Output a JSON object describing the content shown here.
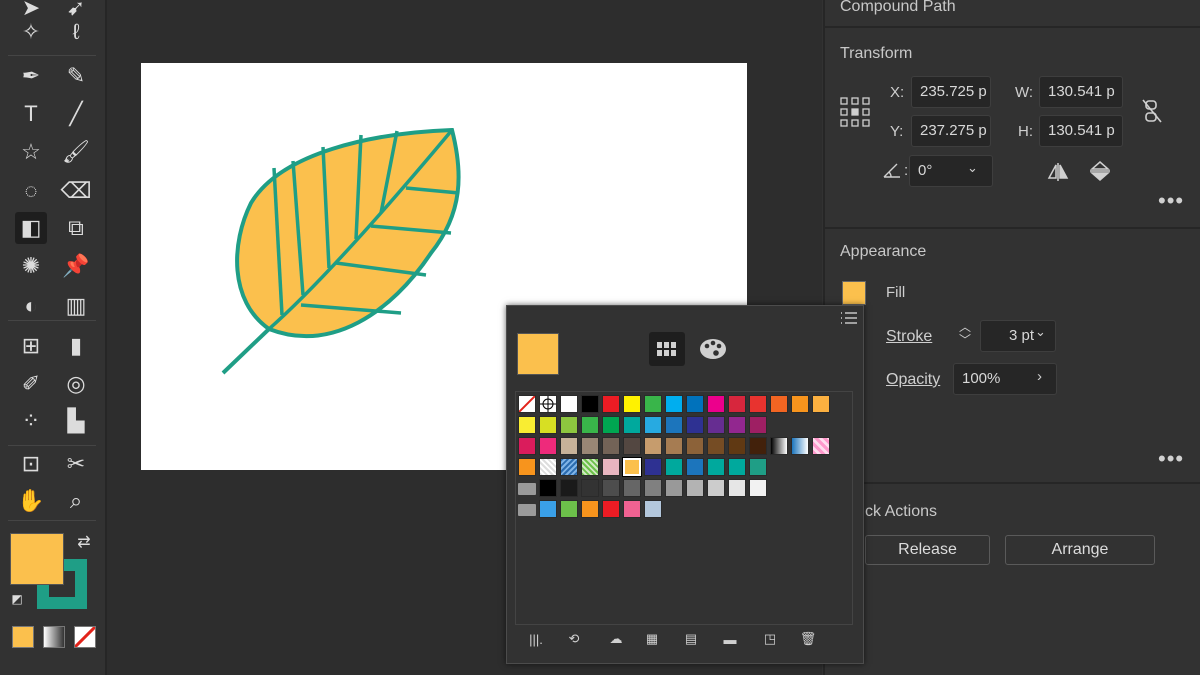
{
  "colors": {
    "accent_fill": "#fbc04d",
    "accent_stroke": "#1f9e86",
    "panel_bg": "#323232"
  },
  "tools": [
    {
      "name": "direct-selection-icon"
    },
    {
      "name": "group-selection-icon"
    },
    {
      "name": "magic-wand-icon"
    },
    {
      "name": "lasso-icon"
    },
    {
      "name": "pen-icon"
    },
    {
      "name": "curvature-icon"
    },
    {
      "name": "type-icon"
    },
    {
      "name": "line-segment-icon"
    },
    {
      "name": "star-icon"
    },
    {
      "name": "paintbrush-icon"
    },
    {
      "name": "shaper-icon"
    },
    {
      "name": "eraser-icon"
    },
    {
      "name": "reflect-icon"
    },
    {
      "name": "free-transform-icon"
    },
    {
      "name": "puppet-warp-icon"
    },
    {
      "name": "pin-icon"
    },
    {
      "name": "shape-builder-icon"
    },
    {
      "name": "perspective-grid-icon"
    },
    {
      "name": "mesh-icon"
    },
    {
      "name": "gradient-icon"
    },
    {
      "name": "eyedropper-icon"
    },
    {
      "name": "blend-icon"
    },
    {
      "name": "symbol-sprayer-icon"
    },
    {
      "name": "column-graph-icon"
    },
    {
      "name": "artboard-icon"
    },
    {
      "name": "slice-icon"
    },
    {
      "name": "hand-icon"
    },
    {
      "name": "zoom-icon"
    }
  ],
  "panel": {
    "header": "Compound Path",
    "transform": {
      "title": "Transform",
      "x_label": "X:",
      "x_value": "235.725 p",
      "y_label": "Y:",
      "y_value": "237.275 p",
      "w_label": "W:",
      "w_value": "130.541 p",
      "h_label": "H:",
      "h_value": "130.541 p",
      "angle_value": "0°"
    },
    "appearance": {
      "title": "Appearance",
      "fill_label": "Fill",
      "stroke_label": "Stroke",
      "stroke_value": "3 pt",
      "opacity_label": "Opacity",
      "opacity_value": "100%"
    },
    "quick_actions": {
      "title": "ck Actions",
      "release_label": "Release",
      "arrange_label": "Arrange"
    }
  },
  "swatch_popup": {
    "rows": [
      [
        "none",
        "registration",
        "#ffffff",
        "#000000",
        "#ec1c24",
        "#fff200",
        "#39b54a",
        "#00aeef",
        "#0072bc",
        "#ec008c",
        "#d7263d",
        "#e8332f",
        "#f26522",
        "#f7941d",
        "#fbb040"
      ],
      [
        "#f9ed32",
        "#d7df23",
        "#8dc63f",
        "#39b54a",
        "#00a651",
        "#00a99d",
        "#27aae1",
        "#1c75bc",
        "#2e3192",
        "#662d91",
        "#92278f",
        "#9e1f63"
      ],
      [
        "#da1c5c",
        "#ee2a7b",
        "#c7b299",
        "#998675",
        "#736357",
        "#534741",
        "#c69c6d",
        "#a67c52",
        "#8c6239",
        "#754c24",
        "#603913",
        "#42210b",
        "grad-bw",
        "grad-blue",
        "pattern-pink"
      ],
      [
        "#f7941d",
        "pattern-a",
        "pattern-b",
        "pattern-c",
        "#e8b5c0",
        "selected-yellow",
        "#2e3192",
        "#00a99d",
        "#1c75bc",
        "#00a99d",
        "#00a99d",
        "#1f9e86"
      ],
      [
        "folder",
        "#000000",
        "#1a1a1a",
        "#333333",
        "#4d4d4d",
        "#666666",
        "#808080",
        "#999999",
        "#b3b3b3",
        "#cccccc",
        "#e6e6e6",
        "#f2f2f2"
      ],
      [
        "folder",
        "#3aa0e8",
        "#6cc04a",
        "#f7941d",
        "#ec1c24",
        "#f06292",
        "#b3c7dc"
      ]
    ]
  }
}
